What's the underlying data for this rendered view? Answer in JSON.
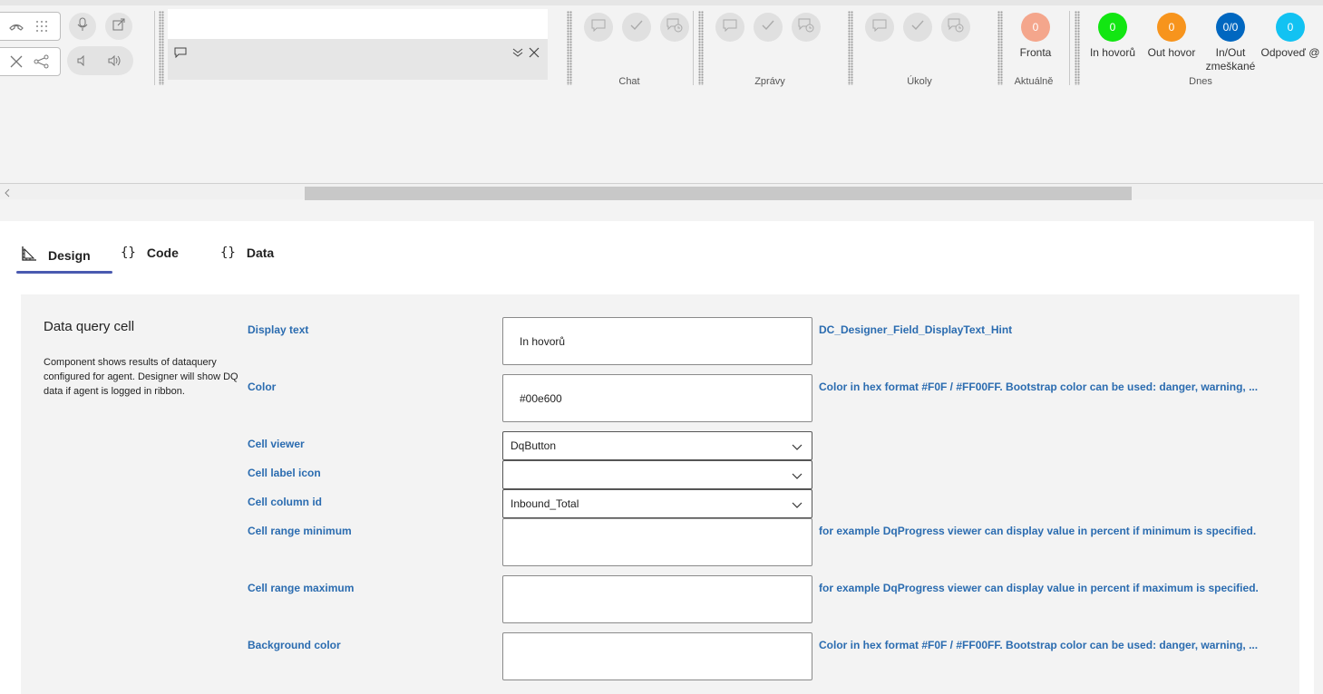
{
  "ribbon": {
    "groups": {
      "chat": "Chat",
      "zpravy": "Zprávy",
      "ukoly": "Úkoly",
      "aktualne": "Aktuálně",
      "dnes": "Dnes"
    },
    "fronta": {
      "value": "0",
      "label": "Fronta",
      "color": "#f4a68c"
    },
    "counters": [
      {
        "value": "0",
        "label": "In hovorů",
        "color": "#12e612"
      },
      {
        "value": "0",
        "label": "Out hovor",
        "color": "#f7941d"
      },
      {
        "value": "0/0",
        "label": "In/Out zmeškané",
        "color": "#0067c0"
      },
      {
        "value": "0",
        "label": "Odpoveď @",
        "color": "#12c2f2"
      }
    ]
  },
  "tabs": [
    {
      "label": "Design",
      "icon": "design-icon",
      "active": true
    },
    {
      "label": "Code",
      "icon": "braces-icon"
    },
    {
      "label": "Data",
      "icon": "braces-icon"
    }
  ],
  "form": {
    "title": "Data query cell",
    "description": "Component shows results of dataquery configured for agent. Designer will show DQ data if agent is logged in ribbon.",
    "fields": {
      "display_text": {
        "label": "Display text",
        "value": "In hovorů",
        "hint": "DC_Designer_Field_DisplayText_Hint"
      },
      "color": {
        "label": "Color",
        "value": "#00e600",
        "hint": "Color in hex format #F0F / #FF00FF. Bootstrap color can be used: danger, warning, ..."
      },
      "cell_viewer": {
        "label": "Cell viewer",
        "value": "DqButton"
      },
      "cell_label_icon": {
        "label": "Cell label icon",
        "value": ""
      },
      "cell_column_id": {
        "label": "Cell column id",
        "value": "Inbound_Total"
      },
      "range_min": {
        "label": "Cell range minimum",
        "value": "",
        "hint": "for example DqProgress viewer can display value in percent if minimum is specified."
      },
      "range_max": {
        "label": "Cell range maximum",
        "value": "",
        "hint": "for example DqProgress viewer can display value in percent if maximum is specified."
      },
      "bg_color": {
        "label": "Background color",
        "value": "",
        "hint": "Color in hex format #F0F / #FF00FF. Bootstrap color can be used: danger, warning, ..."
      }
    }
  }
}
